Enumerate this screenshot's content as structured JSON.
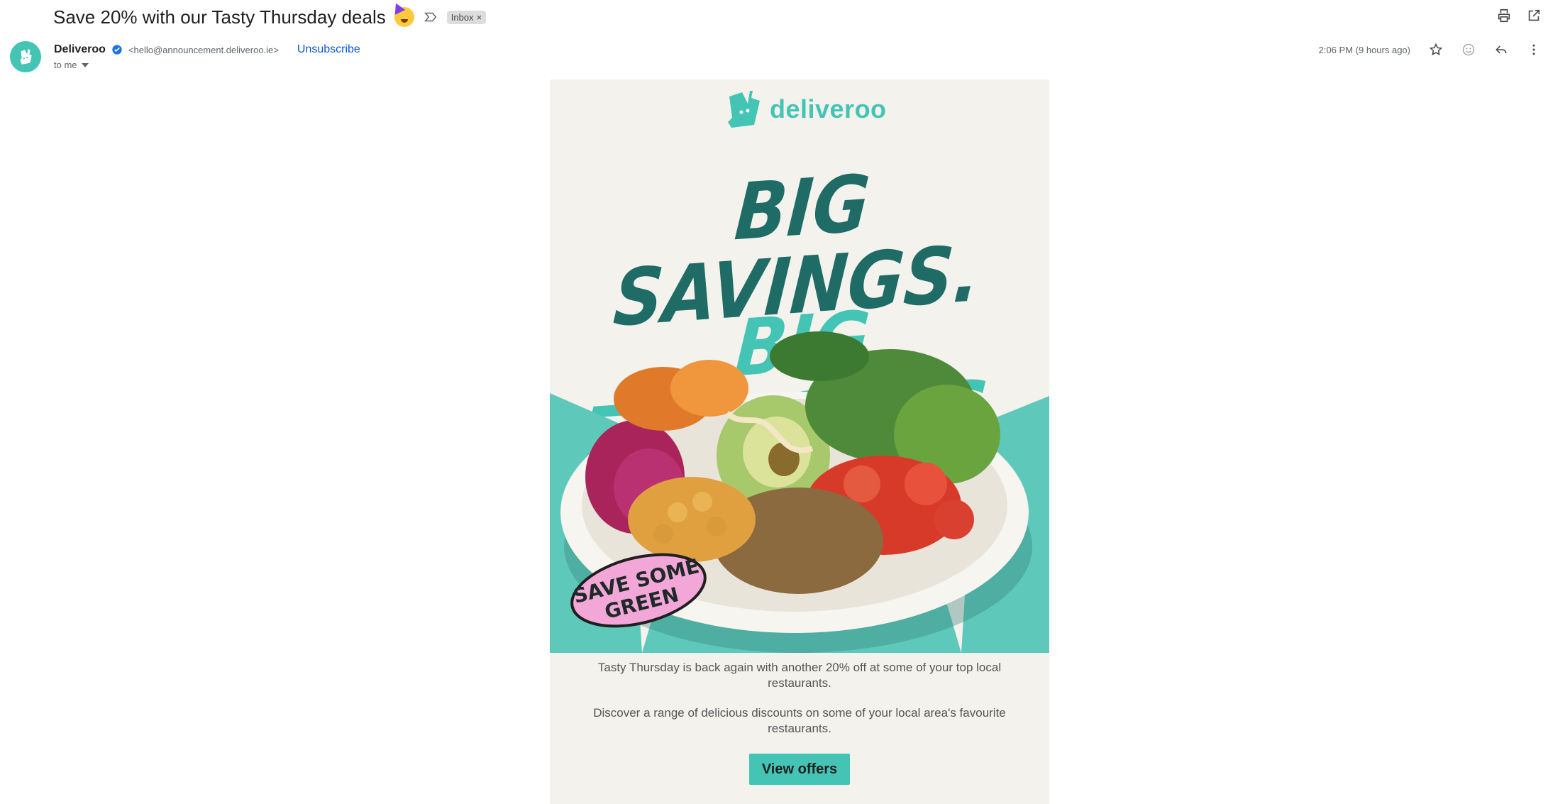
{
  "email": {
    "subject": "Save 20% with our Tasty Thursday deals",
    "subject_emoji": "partying-face-emoji",
    "label": "Inbox",
    "label_remove": "×",
    "sender_name": "Deliveroo",
    "sender_email": "<hello@announcement.deliveroo.ie>",
    "unsubscribe": "Unsubscribe",
    "recipient": "to me",
    "timestamp": "2:06 PM (9 hours ago)"
  },
  "toolbar": {
    "icons": [
      "print-icon",
      "open-in-new-window-icon",
      "star-icon",
      "emoji-react-icon",
      "reply-icon",
      "more-options-icon"
    ]
  },
  "content": {
    "brand": "deliveroo",
    "headline_line1": "BIG SAVINGS.",
    "headline_line2": "BIG FLAVOURS.",
    "sticker_line1": "SAVE SOME",
    "sticker_line2": "GREEN",
    "paragraph1": "Tasty Thursday is back again with another 20% off at some of your top local restaurants.",
    "paragraph2": "Discover a range of delicious discounts on some of your local area's favourite restaurants.",
    "cta_label": "View offers"
  },
  "colors": {
    "brand_teal": "#44c4b4",
    "dark_teal": "#1f6b66",
    "email_background": "#f4f2ed",
    "link_blue": "#0b57d0",
    "sticker_pink": "#f2a7d8"
  }
}
